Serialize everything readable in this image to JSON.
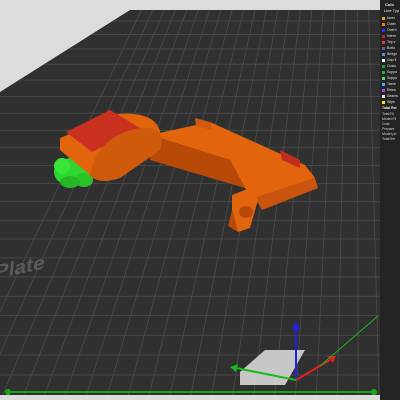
{
  "bed": {
    "label": "Plate"
  },
  "legend": {
    "title": "Colo",
    "subtitle": "Line Typ",
    "items": [
      {
        "label": "Inner",
        "color": "#e8a020"
      },
      {
        "label": "Outer",
        "color": "#ff7b00"
      },
      {
        "label": "Overh",
        "color": "#2c2cff"
      },
      {
        "label": "Intern",
        "color": "#b03030"
      },
      {
        "label": "Top s",
        "color": "#ff3030"
      },
      {
        "label": "Botto",
        "color": "#7050c0"
      },
      {
        "label": "Bridge",
        "color": "#40a0c0"
      },
      {
        "label": "Gap fi",
        "color": "#ffffff"
      },
      {
        "label": "Custo",
        "color": "#2e8b57"
      },
      {
        "label": "Suppo",
        "color": "#10c010"
      },
      {
        "label": "Suppo",
        "color": "#60d060"
      },
      {
        "label": "Trave",
        "color": "#30b0ff"
      },
      {
        "label": "Retra",
        "color": "#b040ff"
      },
      {
        "label": "Seams",
        "color": "#e0e0e0"
      },
      {
        "label": "Wipe",
        "color": "#ffe000"
      }
    ],
    "totals_title": "Total Est",
    "stats": [
      "Total Fil",
      "Model Fil",
      "Cost:",
      "Prepare",
      "Model pri",
      "Total tim"
    ]
  },
  "colors": {
    "bed": "#303030",
    "grid": "#4a4a4a",
    "model_body": "#e2640c",
    "model_shade": "#b84a08",
    "model_top": "#c83020",
    "support": "#2fd62f",
    "axis_x": "#e02020",
    "axis_y": "#18b818",
    "axis_z": "#2020e0"
  }
}
